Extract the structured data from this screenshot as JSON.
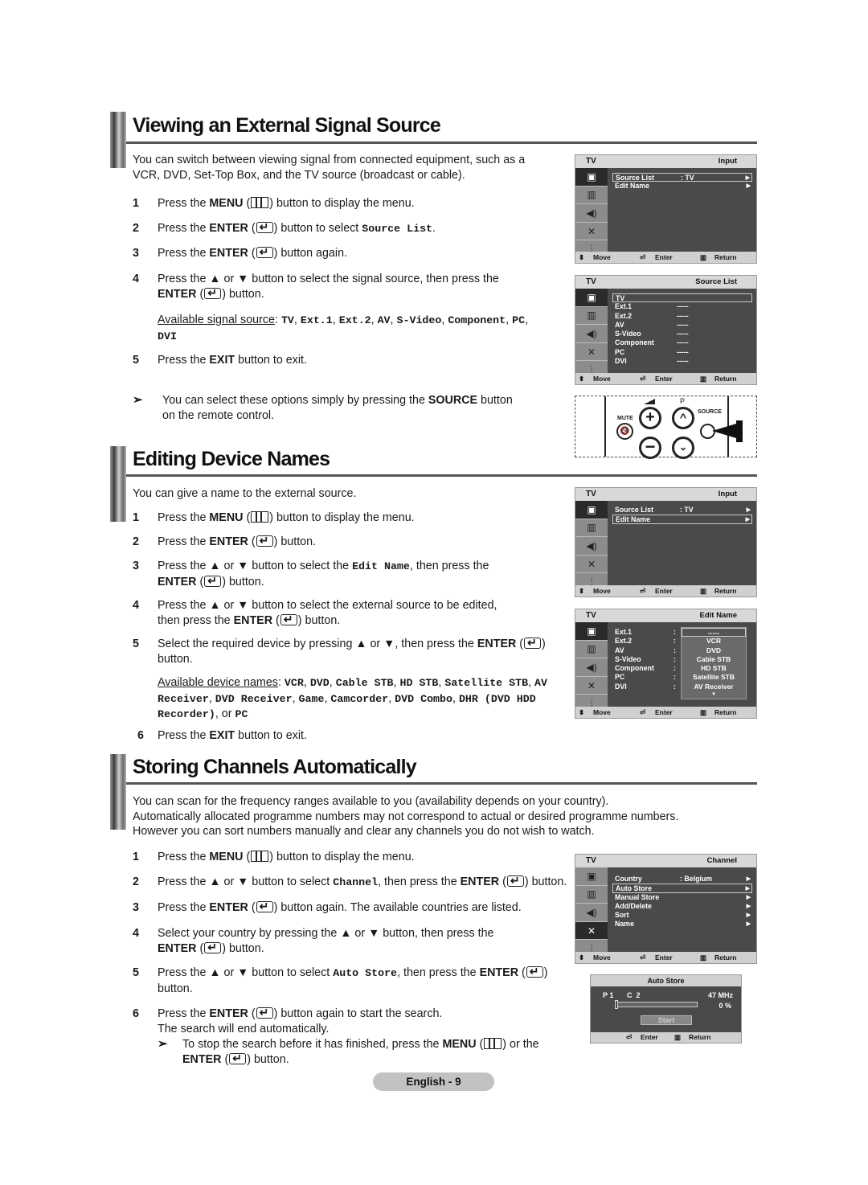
{
  "page_label": "English - 9",
  "sections": {
    "viewing": {
      "title": "Viewing an External Signal Source",
      "intro": [
        "You can switch between viewing signal from connected equipment, such as a",
        "VCR, DVD, Set-Top Box, and the TV source (broadcast or cable)."
      ],
      "steps": [
        {
          "num": "1",
          "pre": "Press the ",
          "key": "MENU",
          "post": " button to display the menu."
        },
        {
          "num": "2",
          "pre": "Press the ",
          "key": "ENTER",
          "post": " button to select ",
          "code": "Source List",
          "end": "."
        },
        {
          "num": "3",
          "pre": "Press the ",
          "key": "ENTER",
          "post": " button again."
        },
        {
          "num": "4",
          "line1": "Press the ▲ or ▼ button to select the signal source, then press the",
          "key": "ENTER",
          "post": " button."
        },
        {
          "num": "5",
          "pre": "Press the ",
          "key": "EXIT",
          "post": " button to exit."
        }
      ],
      "available_label": "Available signal source",
      "available": [
        "TV",
        "Ext.1",
        "Ext.2",
        "AV",
        "S-Video",
        "Component",
        "PC",
        "DVI"
      ],
      "note": {
        "pre": "You can select these options simply by pressing the ",
        "key": "SOURCE",
        "post": " button",
        "line2": "on the remote control."
      }
    },
    "editing": {
      "title": "Editing Device Names",
      "intro": "You can give a name to the external source.",
      "steps": [
        {
          "num": "1",
          "pre": "Press the ",
          "key": "MENU",
          "post": " button to display the menu."
        },
        {
          "num": "2",
          "pre": "Press the ",
          "key": "ENTER",
          "post": " button."
        },
        {
          "num": "3",
          "pre": "Press the ▲ or ▼ button to select the ",
          "code": "Edit Name",
          "post": ", then press the",
          "key": "ENTER",
          "end": " button."
        },
        {
          "num": "4",
          "line1": "Press the ▲ or ▼ button to select the external source to be edited,",
          "pre": "then press the ",
          "key": "ENTER",
          "post": " button."
        },
        {
          "num": "5",
          "pre": "Select the required device by pressing ▲ or ▼, then press the ",
          "key": "ENTER",
          "line2": "button."
        },
        {
          "num": "6",
          "pre": "Press the ",
          "key": "EXIT",
          "post": " button to exit."
        }
      ],
      "available_label": "Available device names",
      "available": [
        "VCR",
        "DVD",
        "Cable STB",
        "HD STB",
        "Satellite STB",
        "AV Receiver",
        "DVD Receiver",
        "Game",
        "Camcorder",
        "DVD Combo",
        "DHR (DVD HDD Recorder)",
        "PC"
      ]
    },
    "storing": {
      "title": "Storing Channels Automatically",
      "intro": [
        "You can scan for the frequency ranges available to you (availability depends on your country).",
        "Automatically allocated programme numbers may not correspond to actual or desired programme numbers.",
        "However you can sort numbers manually and clear any channels you do not wish to watch."
      ],
      "steps": [
        {
          "num": "1",
          "pre": "Press the ",
          "key": "MENU",
          "post": " button to display the menu."
        },
        {
          "num": "2",
          "pre": "Press the ▲ or ▼ button to select ",
          "code": "Channel",
          "post": ", then press the ",
          "key": "ENTER",
          "end": " button."
        },
        {
          "num": "3",
          "pre": "Press the ",
          "key": "ENTER",
          "post": " button again. The available countries are listed."
        },
        {
          "num": "4",
          "line1": "Select your country by pressing the ▲ or ▼ button, then press the",
          "key": "ENTER",
          "post": " button."
        },
        {
          "num": "5",
          "pre": "Press the ▲ or ▼ button to select ",
          "code": "Auto Store",
          "post": ", then press the ",
          "key": "ENTER",
          "line2": "button."
        },
        {
          "num": "6",
          "pre": "Press the ",
          "key": "ENTER",
          "post": " button again to start the search.",
          "line2": "The search will end automatically."
        }
      ],
      "note": {
        "pre": "To stop the search before it has finished, press the ",
        "key": "MENU",
        "post": " or the",
        "key2": "ENTER",
        "end": " button."
      }
    }
  },
  "osd": {
    "tv_label": "TV",
    "footer": {
      "move": "Move",
      "enter": "Enter",
      "return": "Return"
    },
    "input1": {
      "title": "Input",
      "rows": [
        {
          "label": "Source List",
          "value": ": TV",
          "selected": true
        },
        {
          "label": "Edit Name",
          "value": "",
          "selected": false
        }
      ]
    },
    "source_list": {
      "title": "Source List",
      "rows": [
        {
          "label": "TV",
          "value": "",
          "selected": true
        },
        {
          "label": "Ext.1",
          "value": "-----"
        },
        {
          "label": "Ext.2",
          "value": "-----"
        },
        {
          "label": "AV",
          "value": "-----"
        },
        {
          "label": "S-Video",
          "value": "-----"
        },
        {
          "label": "Component",
          "value": "-----"
        },
        {
          "label": "PC",
          "value": "-----"
        },
        {
          "label": "DVI",
          "value": "-----"
        }
      ]
    },
    "input2": {
      "title": "Input",
      "rows": [
        {
          "label": "Source List",
          "value": ": TV",
          "selected": false
        },
        {
          "label": "Edit Name",
          "value": "",
          "selected": true
        }
      ]
    },
    "edit_name": {
      "title": "Edit Name",
      "rows": [
        "Ext.1",
        "Ext.2",
        "AV",
        "S-Video",
        "Component",
        "PC",
        "DVI"
      ],
      "options": [
        "-----",
        "VCR",
        "DVD",
        "Cable STB",
        "HD STB",
        "Satellite STB",
        "AV Receiver"
      ]
    },
    "channel": {
      "title": "Channel",
      "rows": [
        {
          "label": "Country",
          "value": ": Belgium",
          "selected": false
        },
        {
          "label": "Auto Store",
          "value": "",
          "selected": true
        },
        {
          "label": "Manual Store",
          "value": ""
        },
        {
          "label": "Add/Delete",
          "value": ""
        },
        {
          "label": "Sort",
          "value": ""
        },
        {
          "label": "Name",
          "value": ""
        }
      ]
    },
    "auto_store": {
      "title": "Auto Store",
      "program": "P 1",
      "channel": "C  2",
      "frequency": "47 MHz",
      "progress_percent": 0,
      "progress_label": "0 %",
      "start": "Start",
      "enter": "Enter",
      "return": "Return"
    }
  },
  "remote": {
    "mute": "MUTE",
    "p": "P",
    "source": "SOURCE"
  }
}
